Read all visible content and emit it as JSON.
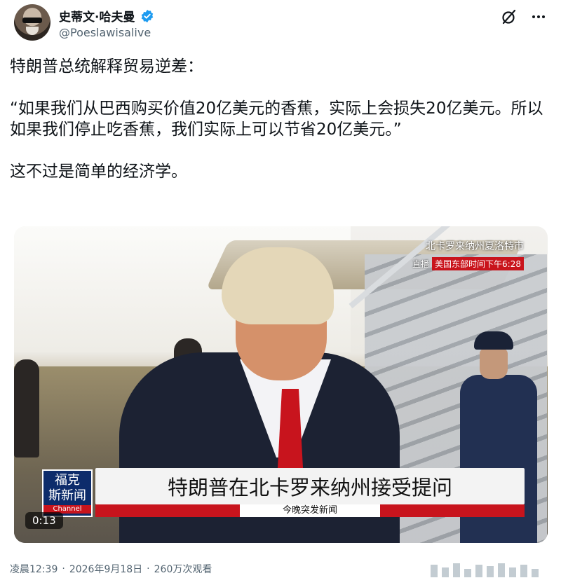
{
  "author": {
    "display_name": "史蒂文·哈夫曼",
    "handle": "@Poeslawisalive",
    "verified": true
  },
  "header_icons": [
    "grok-icon",
    "more-icon"
  ],
  "tweet": {
    "line1": "特朗普总统解释贸易逆差：",
    "quote": "“如果我们从巴西购买价值20亿美元的香蕉，实际上会损失20亿美元。所以如果我们停止吃香蕉，我们实际上可以节省20亿美元。”",
    "line3": "这不过是简单的经济学。"
  },
  "video": {
    "location": "北卡罗来纳州夏洛特市",
    "live_label": "直播",
    "time_label": "美国东部时间下午6:28",
    "headline": "特朗普在北卡罗来纳州接受提问",
    "subline": "今晚突发新闻",
    "logo_line1": "福克",
    "logo_line2": "斯新闻",
    "logo_line3": "Channel",
    "duration": "0:13"
  },
  "meta": {
    "time": "凌晨12:39",
    "date": "2026年9月18日",
    "views": "260万次观看",
    "dot": "·"
  }
}
